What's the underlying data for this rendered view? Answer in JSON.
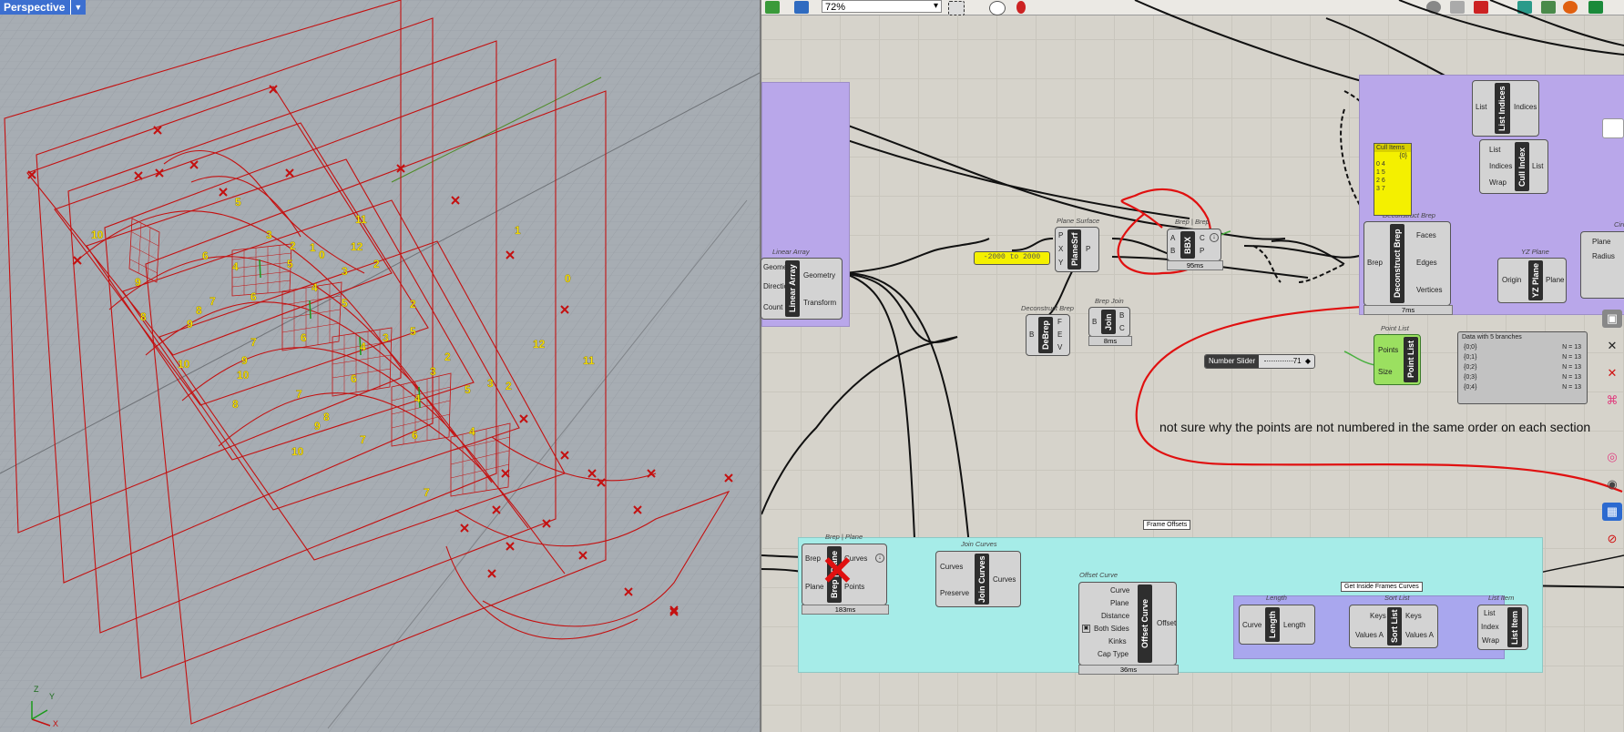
{
  "viewport": {
    "label": "Perspective",
    "axis_x": "X",
    "axis_y": "Y",
    "axis_z": "Z",
    "point_labels": [
      "10",
      "9",
      "8",
      "10",
      "9",
      "8",
      "10",
      "9",
      "8",
      "10",
      "9",
      "8",
      "7",
      "6",
      "5",
      "4",
      "3",
      "2",
      "1",
      "0",
      "12",
      "11",
      "7",
      "6",
      "5",
      "4",
      "3",
      "2",
      "7",
      "6",
      "5",
      "4",
      "3",
      "2",
      "7",
      "6",
      "5",
      "4",
      "3",
      "2",
      "7",
      "6",
      "5",
      "4",
      "3",
      "2",
      "1",
      "0",
      "12",
      "11"
    ]
  },
  "toolbar": {
    "zoom": "72%"
  },
  "groups": {
    "frame_offsets": "Frame Offsets",
    "get_inside_frames": "Get Inside Frames Curves"
  },
  "components": {
    "linear_array": {
      "title": "Linear Array",
      "name": "Linear Array",
      "in1": "Geometry",
      "in2": "Direction",
      "in3": "Count",
      "out1": "Geometry",
      "out2": "Transform"
    },
    "plane_srf": {
      "title": "Plane Surface",
      "name": "PlaneSrf",
      "in1": "P",
      "in2": "X",
      "in3": "Y",
      "out1": "P"
    },
    "range": {
      "text": "-2000 to 2000"
    },
    "bbx": {
      "title": "Brep | Brep",
      "name": "BBX",
      "in1": "A",
      "in2": "B",
      "out1": "C",
      "out2": "P",
      "timing": "95ms"
    },
    "debrep": {
      "title": "Deconstruct Brep",
      "name": "DeBrep",
      "in1": "B",
      "out1": "F",
      "out2": "E",
      "out3": "V"
    },
    "join": {
      "title": "Brep Join",
      "name": "Join",
      "in1": "B",
      "out1": "B",
      "out2": "C",
      "timing": "8ms"
    },
    "deconstruct_brep": {
      "title": "Deconstruct Brep",
      "name": "Deconstruct Brep",
      "in1": "Brep",
      "out1": "Faces",
      "out2": "Edges",
      "out3": "Vertices",
      "timing": "7ms"
    },
    "cull_items": {
      "title": "Cull Items",
      "header": "{0}",
      "rows": [
        "0  4",
        "1  5",
        "2  6",
        "3  7"
      ]
    },
    "list_indices": {
      "name": "List Indices",
      "in1": "List",
      "out1": "Indices"
    },
    "cull_index": {
      "name": "Cull Index",
      "in1": "List",
      "in2": "Indices",
      "in3": "Wrap",
      "out1": "List"
    },
    "yz_plane": {
      "title": "YZ Plane",
      "name": "YZ Plane",
      "in1": "Origin",
      "out1": "Plane"
    },
    "circle": {
      "title": "Circle",
      "in1": "Plane",
      "in2": "Radius"
    },
    "point_list": {
      "title": "Point List",
      "name": "Point List",
      "in1": "Points",
      "in2": "Size"
    },
    "number_slider": {
      "name": "Number Slider",
      "value": "71"
    },
    "data_view": {
      "title": "Data with 5 branches",
      "rows": [
        {
          "path": "{0;0}",
          "n": "N = 13"
        },
        {
          "path": "{0;1}",
          "n": "N = 13"
        },
        {
          "path": "{0;2}",
          "n": "N = 13"
        },
        {
          "path": "{0;3}",
          "n": "N = 13"
        },
        {
          "path": "{0;4}",
          "n": "N = 13"
        }
      ]
    },
    "brep_plane": {
      "title": "Brep | Plane",
      "name": "Brep | Plane",
      "in1": "Brep",
      "in2": "Plane",
      "out1": "Curves",
      "out2": "Points",
      "timing": "183ms"
    },
    "join_curves": {
      "title": "Join Curves",
      "name": "Join Curves",
      "in1": "Curves",
      "in2": "Preserve",
      "out1": "Curves"
    },
    "offset_curve": {
      "title": "Offset Curve",
      "name": "Offset Curve",
      "in1": "Curve",
      "in2": "Plane",
      "in3": "Distance",
      "in4": "Both Sides",
      "in5": "Kinks",
      "in6": "Cap Type",
      "out1": "Offset",
      "timing": "36ms"
    },
    "length": {
      "title": "Length",
      "name": "Length",
      "in1": "Curve",
      "out1": "Length"
    },
    "sort_list": {
      "title": "Sort List",
      "name": "Sort List",
      "in1": "Keys",
      "in2": "Values A",
      "out1": "Keys",
      "out2": "Values A"
    },
    "list_item": {
      "title": "List Item",
      "name": "List Item",
      "in1": "List",
      "in2": "Index",
      "in3": "Wrap"
    }
  },
  "annotation": "not sure why the points are not numbered in the same order on each section",
  "colors": {
    "group_purple": "#b9a7ea",
    "group_cyan": "#a6ece8",
    "group_blue": "#a9a7ee",
    "wire_red": "#e01010",
    "geometry_red": "#c41010",
    "label_yellow": "#ffe600"
  }
}
